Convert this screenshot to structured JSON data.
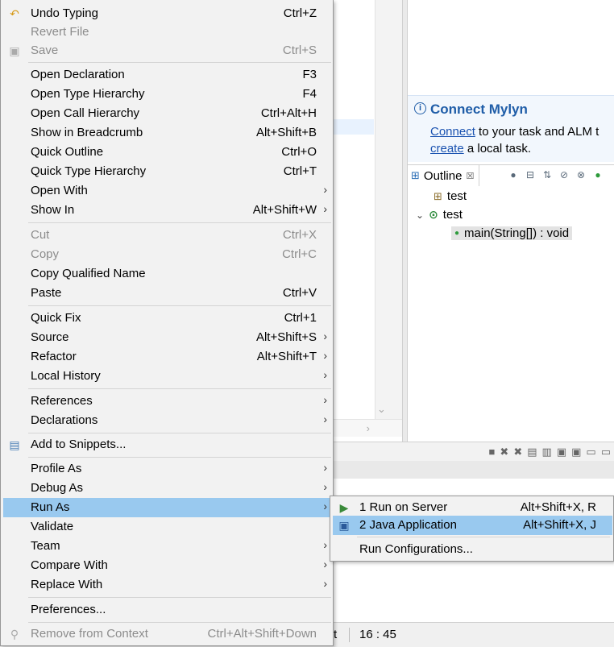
{
  "mylyn": {
    "title": "Connect Mylyn",
    "line1_link": "Connect",
    "line1_rest": " to your task and ALM t",
    "line2_link": "create",
    "line2_rest": " a local task."
  },
  "outline": {
    "tab_label": "Outline",
    "tab_close": "☒",
    "tree": [
      {
        "label": "test",
        "kind": "package"
      },
      {
        "label": "test",
        "kind": "class"
      },
      {
        "label": "main(String[]) : void",
        "kind": "method"
      }
    ]
  },
  "status": {
    "left_fragment": "t",
    "position": "16 : 45"
  },
  "context_menu": {
    "items": [
      {
        "label": "Undo Typing",
        "shortcut": "Ctrl+Z",
        "icon": "undo-icon",
        "disabled": false
      },
      {
        "label": "Revert File",
        "shortcut": "",
        "disabled": true
      },
      {
        "label": "Save",
        "shortcut": "Ctrl+S",
        "icon": "save-icon",
        "disabled": true
      },
      {
        "label": "Open Declaration",
        "shortcut": "F3"
      },
      {
        "label": "Open Type Hierarchy",
        "shortcut": "F4"
      },
      {
        "label": "Open Call Hierarchy",
        "shortcut": "Ctrl+Alt+H"
      },
      {
        "label": "Show in Breadcrumb",
        "shortcut": "Alt+Shift+B"
      },
      {
        "label": "Quick Outline",
        "shortcut": "Ctrl+O"
      },
      {
        "label": "Quick Type Hierarchy",
        "shortcut": "Ctrl+T"
      },
      {
        "label": "Open With",
        "shortcut": "",
        "submenu": true
      },
      {
        "label": "Show In",
        "shortcut": "Alt+Shift+W",
        "submenu": true
      },
      {
        "label": "Cut",
        "shortcut": "Ctrl+X",
        "disabled": true
      },
      {
        "label": "Copy",
        "shortcut": "Ctrl+C",
        "disabled": true
      },
      {
        "label": "Copy Qualified Name",
        "shortcut": ""
      },
      {
        "label": "Paste",
        "shortcut": "Ctrl+V"
      },
      {
        "label": "Quick Fix",
        "shortcut": "Ctrl+1"
      },
      {
        "label": "Source",
        "shortcut": "Alt+Shift+S",
        "submenu": true
      },
      {
        "label": "Refactor",
        "shortcut": "Alt+Shift+T",
        "submenu": true
      },
      {
        "label": "Local History",
        "shortcut": "",
        "submenu": true
      },
      {
        "label": "References",
        "shortcut": "",
        "submenu": true
      },
      {
        "label": "Declarations",
        "shortcut": "",
        "submenu": true
      },
      {
        "label": "Add to Snippets...",
        "shortcut": "",
        "icon": "snippets-icon"
      },
      {
        "label": "Profile As",
        "shortcut": "",
        "submenu": true
      },
      {
        "label": "Debug As",
        "shortcut": "",
        "submenu": true
      },
      {
        "label": "Run As",
        "shortcut": "",
        "submenu": true,
        "highlighted": true
      },
      {
        "label": "Validate",
        "shortcut": ""
      },
      {
        "label": "Team",
        "shortcut": "",
        "submenu": true
      },
      {
        "label": "Compare With",
        "shortcut": "",
        "submenu": true
      },
      {
        "label": "Replace With",
        "shortcut": "",
        "submenu": true
      },
      {
        "label": "Preferences...",
        "shortcut": ""
      },
      {
        "label": "Remove from Context",
        "shortcut": "Ctrl+Alt+Shift+Down",
        "icon": "remove-context-icon",
        "disabled": true
      }
    ],
    "submenu_arrow": "›"
  },
  "run_as_menu": {
    "items": [
      {
        "label": "1 Run on Server",
        "shortcut": "Alt+Shift+X, R",
        "icon": "server-run-icon"
      },
      {
        "label": "2 Java Application",
        "shortcut": "Alt+Shift+X, J",
        "icon": "java-app-icon",
        "highlighted": true
      },
      {
        "label": "Run Configurations...",
        "shortcut": ""
      }
    ]
  },
  "colors": {
    "menu_bg": "#f2f2f2",
    "highlight": "#99c9ef",
    "disabled_text": "#8c8c8c",
    "link": "#1a52b0",
    "mylyn_title": "#1f5da8"
  }
}
